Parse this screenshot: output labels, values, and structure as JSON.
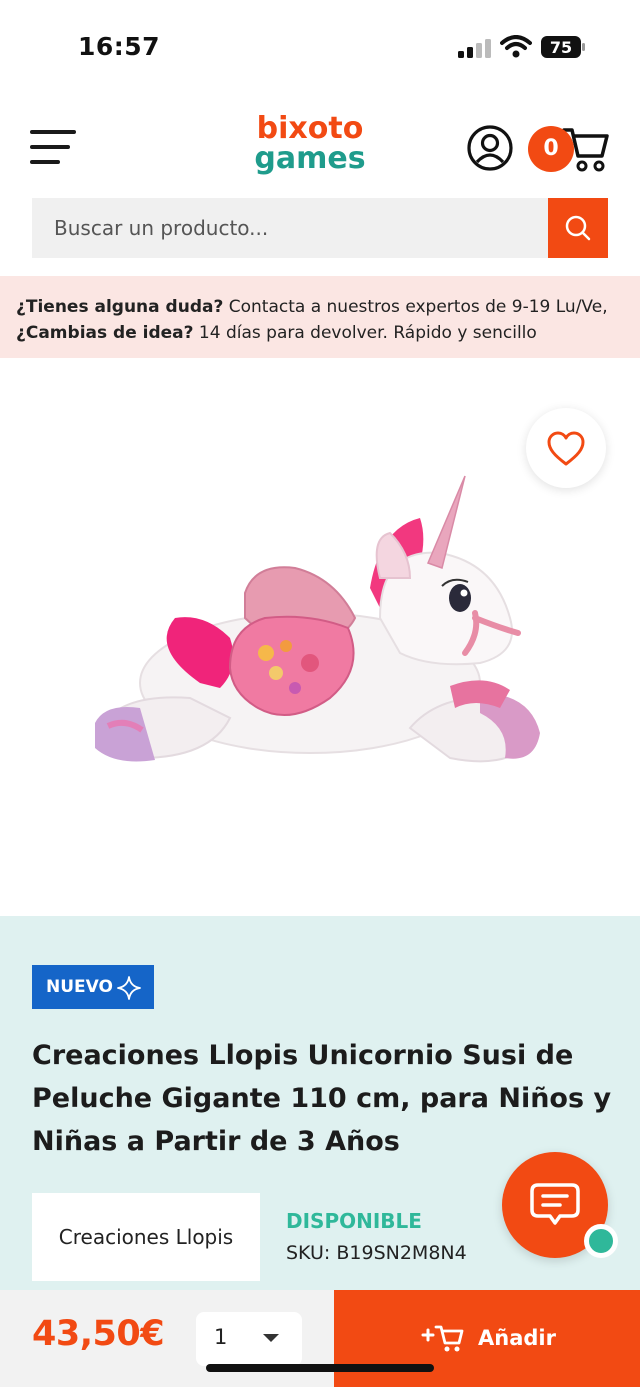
{
  "status_bar": {
    "time": "16:57",
    "battery": "75"
  },
  "header": {
    "logo_line1": "bixoto",
    "logo_line2": "games",
    "cart_count": "0"
  },
  "search": {
    "placeholder": "Buscar un producto..."
  },
  "banner": {
    "question1": "¿Tienes alguna duda?",
    "text1": " Contacta a nuestros expertos de 9-19 Lu/Ve,",
    "question2": "¿Cambias de idea?",
    "text2": " 14 días para devolver. Rápido y sencillo"
  },
  "product": {
    "badge": "NUEVO",
    "title": "Creaciones Llopis Unicornio Susi de Peluche Gigante 110 cm, para Niños y Niñas a Partir de 3 Años",
    "brand": "Creaciones Llopis",
    "stock": "DISPONIBLE",
    "sku": "SKU: B19SN2M8N4"
  },
  "purchase": {
    "price": "43,50€",
    "quantity": "1",
    "add_label": "Añadir"
  },
  "colors": {
    "brand_orange": "#f24a13",
    "brand_teal": "#1f9c8c",
    "badge_blue": "#1565c8",
    "stock_green": "#2fb89a",
    "details_bg": "#dff1f0",
    "banner_bg": "#fbe6e3"
  }
}
